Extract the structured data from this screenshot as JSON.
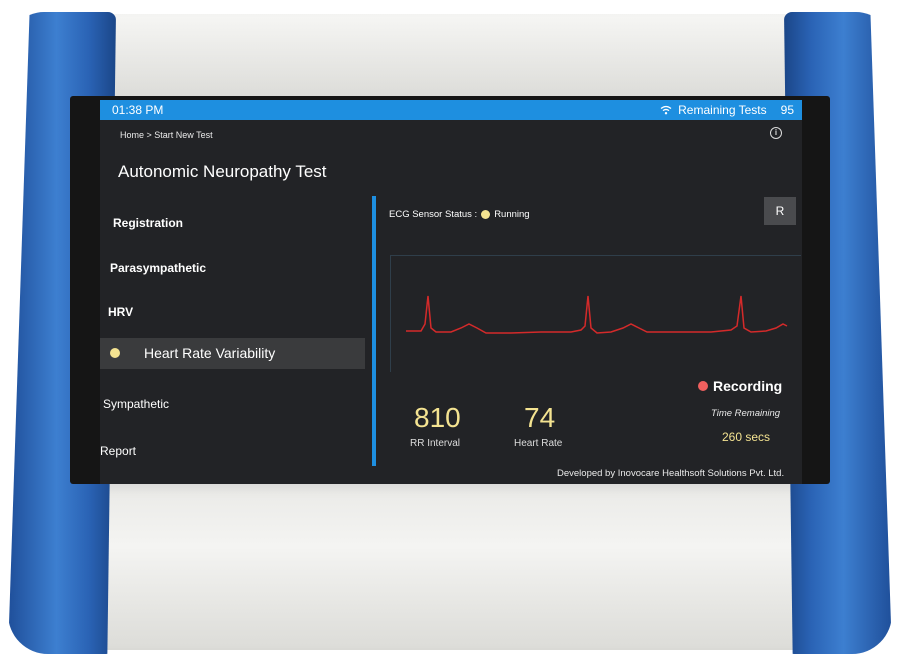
{
  "statusbar": {
    "time": "01:38 PM",
    "remaining_label": "Remaining Tests",
    "remaining_count": "95",
    "wifi_icon": "wifi-icon"
  },
  "breadcrumb": "Home > Start New Test",
  "title": "Autonomic Neuropathy Test",
  "sidebar": {
    "items": [
      {
        "label": "Registration"
      },
      {
        "label": "Parasympathetic"
      },
      {
        "label": "HRV"
      },
      {
        "label": "Heart Rate Variability"
      },
      {
        "label": "Sympathetic"
      },
      {
        "label": "Report"
      }
    ]
  },
  "ecg": {
    "status_label": "ECG Sensor Status :",
    "status_value": "Running",
    "reset_label": "R"
  },
  "recording": {
    "label": "Recording",
    "time_remaining_label": "Time Remaining",
    "time_remaining_value": "260 secs"
  },
  "metrics": {
    "rr_interval": {
      "value": "810",
      "label": "RR Interval"
    },
    "heart_rate": {
      "value": "74",
      "label": "Heart Rate"
    }
  },
  "footer": "Developed by Inovocare Healthsoft Solutions Pvt. Ltd.",
  "colors": {
    "accent": "#1e8fe0",
    "status_dot": "#f4e391",
    "recording_dot": "#f0605f",
    "trace": "#d42a2a"
  }
}
